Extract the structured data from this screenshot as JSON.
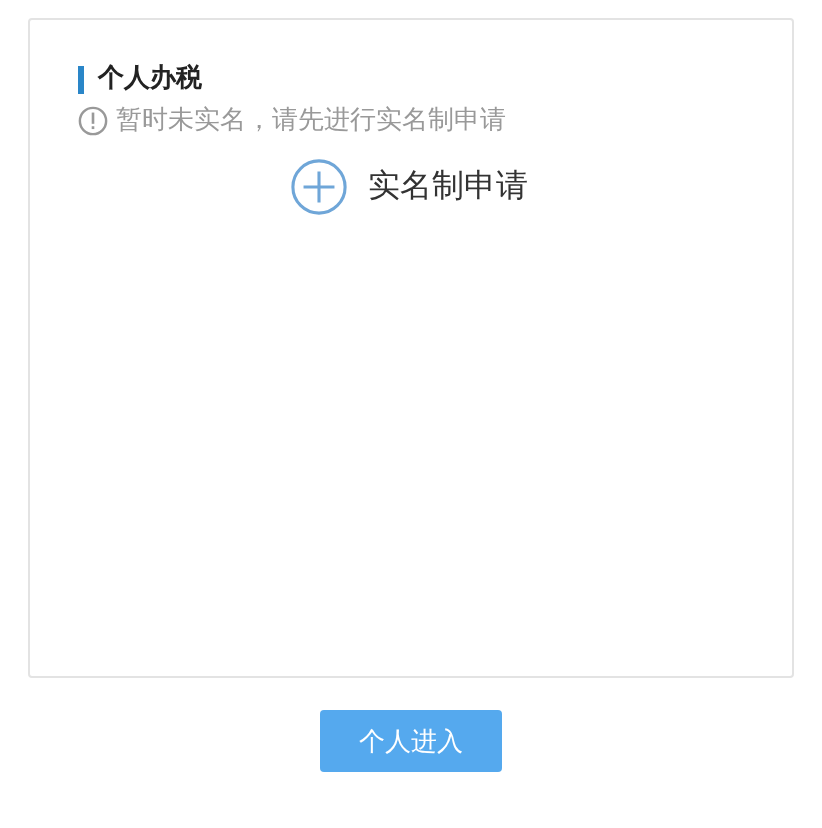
{
  "section_title": "个人办税",
  "notice": "暂时未实名，请先进行实名制申请",
  "apply_link": "实名制申请",
  "enter_button": "个人进入"
}
